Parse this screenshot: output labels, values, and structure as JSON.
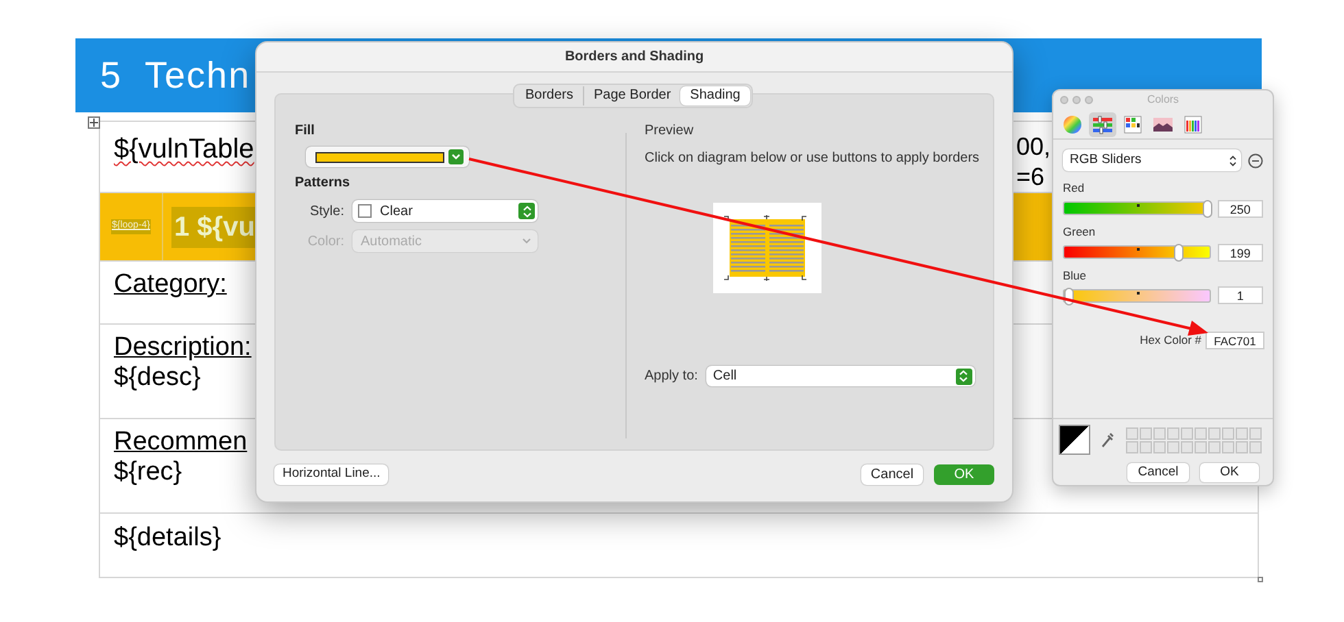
{
  "document": {
    "heading": "5  Techn",
    "rows": [
      {
        "kind": "template",
        "text": "${vulnTable",
        "fragments": [
          "00,",
          "=6"
        ]
      },
      {
        "kind": "shaded",
        "color": "#f7bd05",
        "cells": [
          "${loop-4}",
          "1 ${vu"
        ]
      },
      {
        "kind": "field",
        "label": "Category:"
      },
      {
        "kind": "field",
        "label": "Description:",
        "value": "${desc}"
      },
      {
        "kind": "field",
        "label": "Recommen",
        "value": "${rec}"
      },
      {
        "kind": "text",
        "text": "${details}"
      }
    ]
  },
  "dialog": {
    "title": "Borders and Shading",
    "tabs": [
      {
        "label": "Borders",
        "selected": false
      },
      {
        "label": "Page Border",
        "selected": false
      },
      {
        "label": "Shading",
        "selected": true
      }
    ],
    "fill": {
      "label": "Fill",
      "color": "#fac701"
    },
    "patterns": {
      "label": "Patterns",
      "style_label": "Style:",
      "style_value": "Clear",
      "color_label": "Color:",
      "color_value": "Automatic",
      "color_disabled": true
    },
    "preview": {
      "label": "Preview",
      "hint": "Click on diagram below or use buttons to apply borders"
    },
    "apply_to": {
      "label": "Apply to:",
      "value": "Cell"
    },
    "buttons": {
      "horizontal_line": "Horizontal Line...",
      "cancel": "Cancel",
      "ok": "OK"
    }
  },
  "colors": {
    "title": "Colors",
    "modes": [
      {
        "kind": "wheel",
        "selected": false
      },
      {
        "kind": "sliders",
        "selected": true
      },
      {
        "kind": "palettes",
        "selected": false
      },
      {
        "kind": "image",
        "selected": false
      },
      {
        "kind": "pencils",
        "selected": false
      }
    ],
    "mode_menu": "RGB Sliders",
    "sliders": [
      {
        "name": "Red",
        "level": 0.98,
        "reading": "250"
      },
      {
        "name": "Green",
        "level": 0.78,
        "reading": "199"
      },
      {
        "name": "Blue",
        "level": 0.0,
        "reading": "1"
      }
    ],
    "hex_label": "Hex Color #",
    "hex_value": "FAC701",
    "buttons": {
      "cancel": "Cancel",
      "ok": "OK"
    }
  }
}
